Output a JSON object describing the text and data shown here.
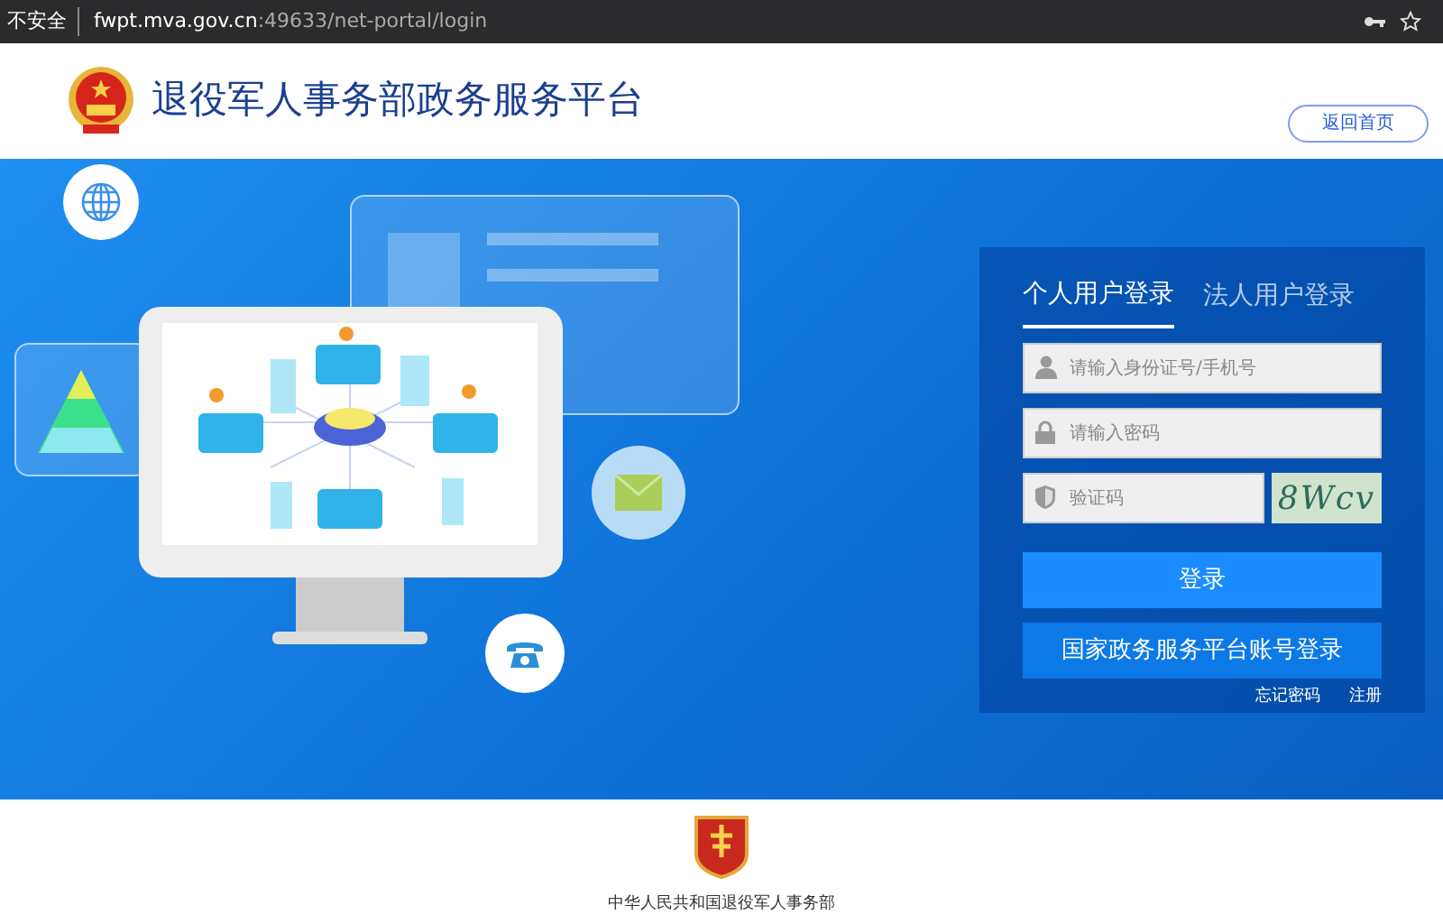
{
  "address_bar": {
    "security_label": "不安全",
    "url_host": "fwpt.mva.gov.cn",
    "url_path": ":49633/net-portal/login"
  },
  "header": {
    "title": "退役军人事务部政务服务平台",
    "home_button": "返回首页"
  },
  "login": {
    "tabs": [
      {
        "label": "个人用户登录",
        "selected": true
      },
      {
        "label": "法人用户登录",
        "selected": false
      }
    ],
    "fields": [
      {
        "kind": "user",
        "placeholder": "请输入身份证号/手机号"
      },
      {
        "kind": "password",
        "placeholder": "请输入密码"
      },
      {
        "kind": "captcha",
        "placeholder": "验证码",
        "captcha_text": "8Wcv"
      }
    ],
    "submit_button": "登录",
    "national_login_button": "国家政务服务平台账号登录",
    "links": [
      "忘记密码",
      "注册"
    ]
  },
  "footer": {
    "text": "中华人民共和国退役军人事务部"
  }
}
